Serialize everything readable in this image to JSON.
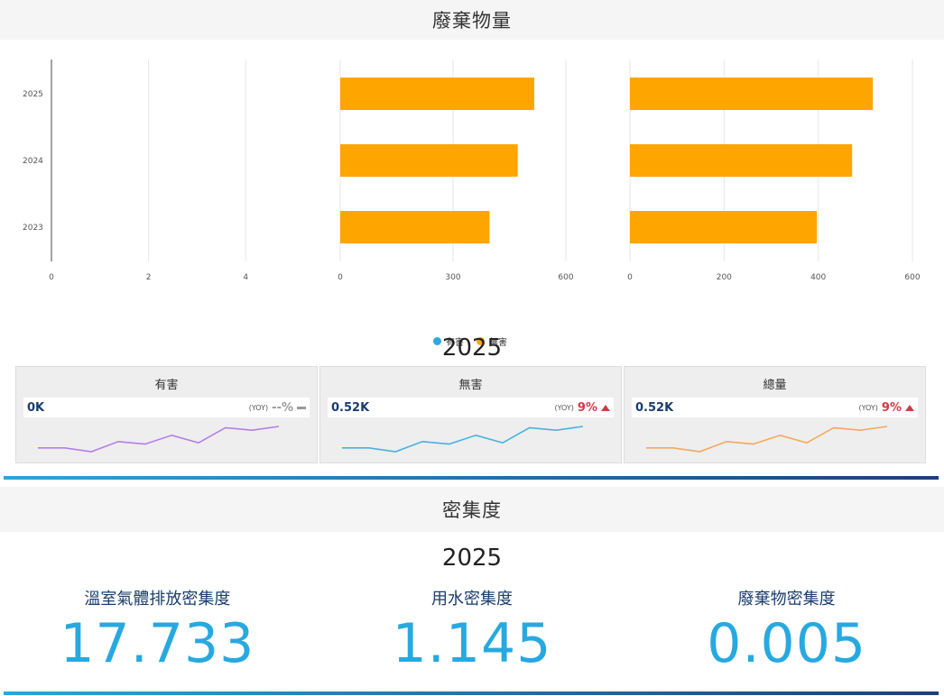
{
  "waste_section": {
    "title": "廢棄物量",
    "year": "2025",
    "legend": [
      {
        "label": "有害",
        "color": "#29abe2"
      },
      {
        "label": "無害",
        "color": "#ffa500"
      }
    ]
  },
  "chart_data": [
    {
      "type": "bar",
      "orientation": "horizontal",
      "categories": [
        "2025",
        "2024",
        "2023"
      ],
      "series": [
        {
          "name": "有害",
          "values": [
            0,
            0,
            0
          ],
          "color": "#29abe2"
        }
      ],
      "xlim": [
        0,
        5
      ],
      "xticks": [
        0,
        2,
        4
      ]
    },
    {
      "type": "bar",
      "orientation": "horizontal",
      "categories": [
        "2025",
        "2024",
        "2023"
      ],
      "series": [
        {
          "name": "無害",
          "values": [
            516,
            472,
            397
          ],
          "color": "#ffa500"
        }
      ],
      "xlim": [
        0,
        720
      ],
      "xticks": [
        0,
        300,
        600
      ]
    },
    {
      "type": "bar",
      "orientation": "horizontal",
      "categories": [
        "2025",
        "2024",
        "2023"
      ],
      "series": [
        {
          "values": [
            516,
            472,
            397
          ],
          "color": "#ffa500"
        }
      ],
      "xlim": [
        0,
        600
      ],
      "xticks": [
        0,
        200,
        400,
        600
      ]
    }
  ],
  "kpis": [
    {
      "title": "有害",
      "value": "0K",
      "yoy_label": "(YOY)",
      "yoy": "--%",
      "trend": "flat",
      "color": "#b57ee8",
      "spark": [
        8,
        8,
        5,
        13,
        11,
        18,
        12,
        24,
        22,
        25
      ]
    },
    {
      "title": "無害",
      "value": "0.52K",
      "yoy_label": "(YOY)",
      "yoy": "9%",
      "trend": "up",
      "color": "#46b2e0",
      "spark": [
        8,
        8,
        5,
        13,
        11,
        18,
        12,
        24,
        22,
        25
      ]
    },
    {
      "title": "總量",
      "value": "0.52K",
      "yoy_label": "(YOY)",
      "yoy": "9%",
      "trend": "up",
      "color": "#f5a85a",
      "spark": [
        8,
        8,
        5,
        13,
        11,
        18,
        12,
        24,
        22,
        25
      ]
    }
  ],
  "density_section": {
    "title": "密集度",
    "year": "2025",
    "items": [
      {
        "label": "溫室氣體排放密集度",
        "value": "17.733"
      },
      {
        "label": "用水密集度",
        "value": "1.145"
      },
      {
        "label": "廢棄物密集度",
        "value": "0.005"
      }
    ]
  },
  "colors": {
    "accent": "#27a9e0",
    "navy": "#1a3d6e",
    "up": "#d13a48",
    "flat": "#999999"
  }
}
